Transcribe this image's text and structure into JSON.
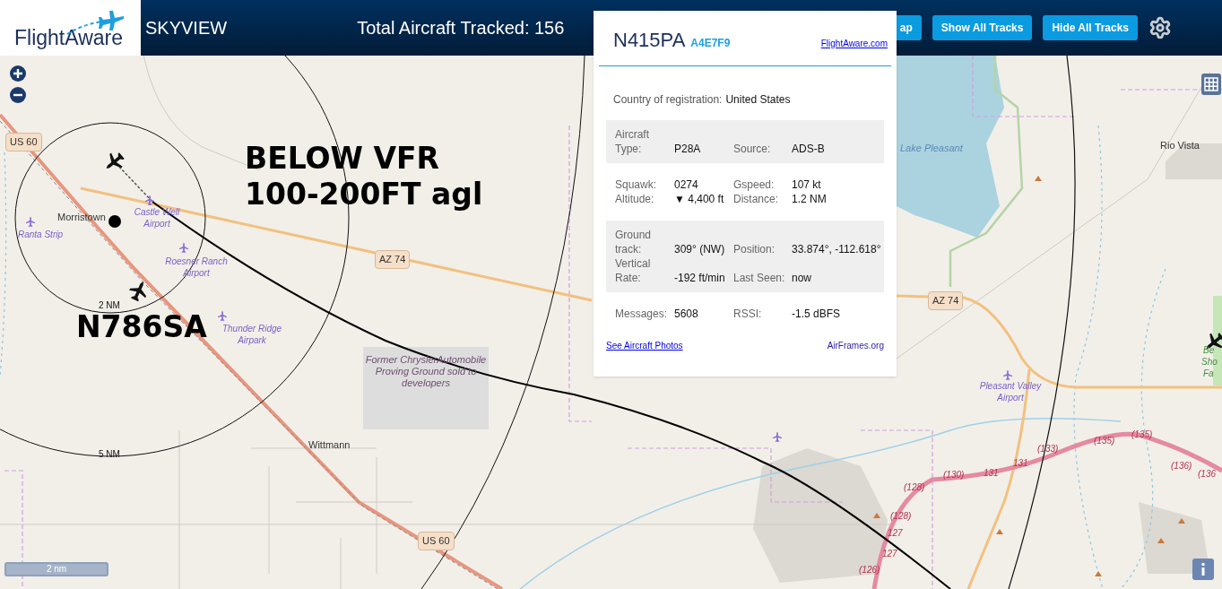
{
  "header": {
    "logo": "FlightAware",
    "title": "SKYVIEW",
    "total": "Total Aircraft Tracked: 156",
    "buttons": [
      {
        "label": "ap"
      },
      {
        "label": "Show All Tracks"
      },
      {
        "label": "Hide All Tracks"
      }
    ]
  },
  "map_labels": [
    {
      "kind": "shield",
      "text": "US 60"
    },
    {
      "kind": "place",
      "text": "Morristown"
    },
    {
      "kind": "airport",
      "text": "Castle Well Airport"
    },
    {
      "kind": "airport",
      "text": "Ranta Strip"
    },
    {
      "kind": "airport",
      "text": "Roesner Ranch Airport"
    },
    {
      "kind": "ring",
      "text": "2 NM"
    },
    {
      "kind": "airport",
      "text": "Thunder Ridge Airpark"
    },
    {
      "kind": "shield",
      "text": "AZ 74"
    },
    {
      "kind": "area",
      "text": "Former ChryslerAutomobile Proving Ground sold to developers"
    },
    {
      "kind": "place",
      "text": "Wittmann"
    },
    {
      "kind": "ring",
      "text": "5 NM"
    },
    {
      "kind": "shield",
      "text": "US 60"
    },
    {
      "kind": "water",
      "text": "Lake Pleasant"
    },
    {
      "kind": "place",
      "text": "Rio Vista"
    },
    {
      "kind": "shield",
      "text": "AZ 74"
    },
    {
      "kind": "park",
      "text": "Be"
    },
    {
      "kind": "park",
      "text": "Sho"
    },
    {
      "kind": "park",
      "text": "Fa"
    },
    {
      "kind": "airport",
      "text": "Pleasant Valley Airport"
    },
    {
      "kind": "route",
      "text": "(135)"
    },
    {
      "kind": "route",
      "text": "(135)"
    },
    {
      "kind": "route",
      "text": "(133)"
    },
    {
      "kind": "route",
      "text": "131"
    },
    {
      "kind": "route",
      "text": "(130)"
    },
    {
      "kind": "route",
      "text": "131"
    },
    {
      "kind": "route",
      "text": "(128)"
    },
    {
      "kind": "route",
      "text": "(128)"
    },
    {
      "kind": "route",
      "text": "127"
    },
    {
      "kind": "route",
      "text": "127"
    },
    {
      "kind": "route",
      "text": "(126)"
    },
    {
      "kind": "route",
      "text": "(136)"
    },
    {
      "kind": "route",
      "text": "(136"
    }
  ],
  "annotations": [
    "BELOW VFR",
    "100-200FT agl",
    "N786SA"
  ],
  "scale": "2 nm",
  "popup": {
    "registration": "N415PA",
    "hex": "A4E7F9",
    "link": "FlightAware.com",
    "country_label": "Country of registration:",
    "country": "United States",
    "sections": [
      {
        "shaded": true,
        "rows": [
          [
            "Aircraft Type:",
            "P28A",
            "Source:",
            "ADS-B"
          ]
        ]
      },
      {
        "shaded": false,
        "rows": [
          [
            "Squawk:",
            "0274",
            "Gspeed:",
            "107 kt"
          ],
          [
            "Altitude:",
            "▼ 4,400 ft",
            "Distance:",
            "1.2 NM"
          ]
        ]
      },
      {
        "shaded": true,
        "rows": [
          [
            "Ground track:",
            "309° (NW)",
            "Position:",
            "33.874°, -112.618°"
          ],
          [
            "Vertical Rate:",
            "-192 ft/min",
            "Last Seen:",
            "now"
          ]
        ]
      },
      {
        "shaded": false,
        "rows": [
          [
            "Messages:",
            "5608",
            "RSSI:",
            "-1.5 dBFS"
          ]
        ]
      }
    ],
    "links": [
      "See Aircraft Photos",
      "AirFrames.org"
    ]
  }
}
